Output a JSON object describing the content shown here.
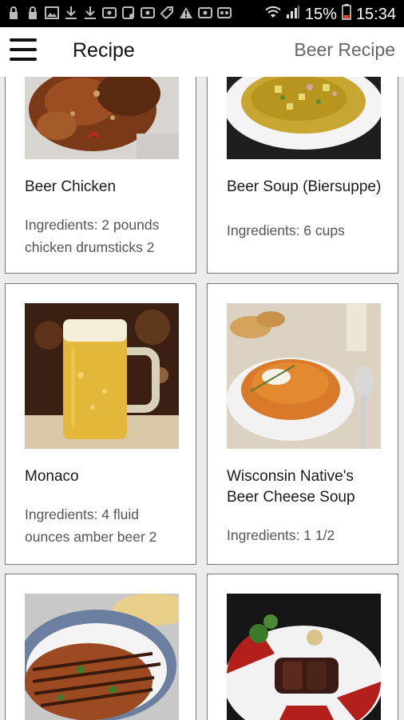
{
  "status_bar": {
    "battery": "15%",
    "time": "15:34"
  },
  "app_bar": {
    "title": "Recipe",
    "subtitle": "Beer Recipe"
  },
  "recipes": [
    {
      "title": "Beer Chicken",
      "ingredients": "Ingredients: 2 pounds chicken drumsticks 2"
    },
    {
      "title": "Beer Soup (Biersuppe)",
      "ingredients": "Ingredients: 6 cups"
    },
    {
      "title": "Monaco",
      "ingredients": "Ingredients: 4 fluid ounces amber beer 2"
    },
    {
      "title": "Wisconsin Native's Beer Cheese Soup",
      "ingredients": "Ingredients: 1 1/2"
    },
    {
      "title": "",
      "ingredients": ""
    },
    {
      "title": "",
      "ingredients": ""
    }
  ],
  "colors": {
    "status_bar": "#000000",
    "app_bar": "#ffffff",
    "background": "#ececec",
    "card_border": "#777777"
  }
}
